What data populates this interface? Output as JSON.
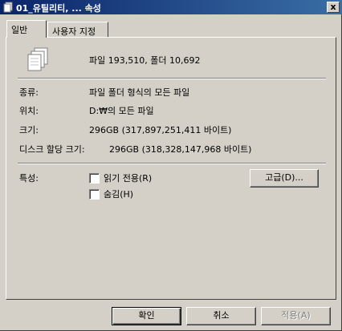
{
  "window": {
    "title": "01_유틸리티, ... 속성",
    "close_label": "x"
  },
  "tabs": [
    {
      "label": "일반",
      "active": true
    },
    {
      "label": "사용자 지정",
      "active": false
    }
  ],
  "summary": {
    "counts": "파일 193,510, 폴더 10,692"
  },
  "details": {
    "type_label": "종류:",
    "type_value": "파일 폴더 형식의 모든 파일",
    "location_label": "위치:",
    "location_value": "D:₩의 모든 파일",
    "size_label": "크기:",
    "size_value": "296GB (317,897,251,411 바이트)",
    "disk_size_label": "디스크 할당 크기:",
    "disk_size_value": "296GB (318,328,147,968 바이트)"
  },
  "attributes": {
    "label": "특성:",
    "readonly_label": "읽기 전용(R)",
    "readonly_checked": false,
    "hidden_label": "숨김(H)",
    "hidden_checked": false,
    "advanced_button": "고급(D)..."
  },
  "buttons": {
    "ok": "확인",
    "cancel": "취소",
    "apply": "적용(A)"
  },
  "colors": {
    "title_bar": "#0a246a",
    "face": "#d4d0c8"
  },
  "icons": {
    "title": "folder-properties-icon",
    "files": "multiple-files-icon"
  }
}
